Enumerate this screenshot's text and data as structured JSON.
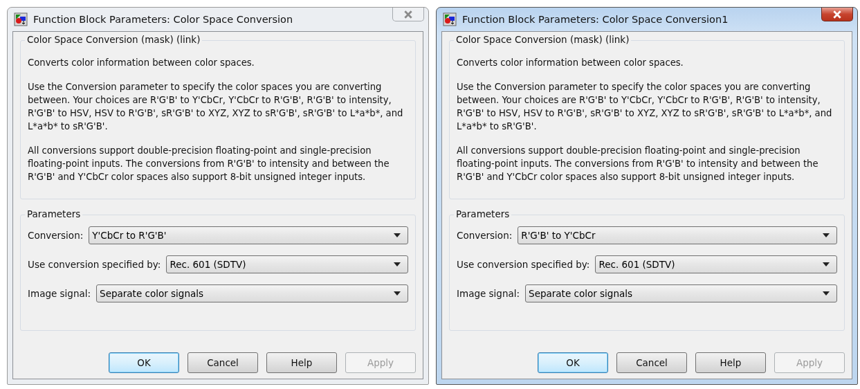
{
  "windows": [
    {
      "title": "Function Block Parameters: Color Space Conversion",
      "active": false,
      "description_group": {
        "title": "Color Space Conversion (mask) (link)",
        "paragraphs": [
          "Converts color information between color spaces.",
          "Use the Conversion parameter to specify the color spaces you are converting between. Your choices are R'G'B' to Y'CbCr, Y'CbCr to R'G'B', R'G'B' to intensity, R'G'B' to HSV, HSV to R'G'B', sR'G'B' to XYZ, XYZ to sR'G'B', sR'G'B' to L*a*b*, and L*a*b* to sR'G'B'.",
          "All conversions support double-precision floating-point and single-precision floating-point inputs. The conversions from R'G'B' to intensity and between the R'G'B' and Y'CbCr color spaces also support 8-bit unsigned integer inputs."
        ]
      },
      "parameters_group": {
        "title": "Parameters",
        "fields": [
          {
            "label": "Conversion:",
            "value": "Y'CbCr to R'G'B'"
          },
          {
            "label": "Use conversion specified by:",
            "value": "Rec. 601 (SDTV)"
          },
          {
            "label": "Image signal:",
            "value": "Separate color signals"
          }
        ]
      },
      "buttons": [
        {
          "label": "OK",
          "default": true,
          "disabled": false
        },
        {
          "label": "Cancel",
          "default": false,
          "disabled": false
        },
        {
          "label": "Help",
          "default": false,
          "disabled": false
        },
        {
          "label": "Apply",
          "default": false,
          "disabled": true
        }
      ]
    },
    {
      "title": "Function Block Parameters: Color Space Conversion1",
      "active": true,
      "description_group": {
        "title": "Color Space Conversion (mask) (link)",
        "paragraphs": [
          "Converts color information between color spaces.",
          "Use the Conversion parameter to specify the color spaces you are converting between. Your choices are R'G'B' to Y'CbCr, Y'CbCr to R'G'B', R'G'B' to intensity, R'G'B' to HSV, HSV to R'G'B', sR'G'B' to XYZ, XYZ to sR'G'B', sR'G'B' to L*a*b*, and L*a*b* to sR'G'B'.",
          "All conversions support double-precision floating-point and single-precision floating-point inputs. The conversions from R'G'B' to intensity and between the R'G'B' and Y'CbCr color spaces also support 8-bit unsigned integer inputs."
        ]
      },
      "parameters_group": {
        "title": "Parameters",
        "fields": [
          {
            "label": "Conversion:",
            "value": "R'G'B' to Y'CbCr"
          },
          {
            "label": "Use conversion specified by:",
            "value": "Rec. 601 (SDTV)"
          },
          {
            "label": "Image signal:",
            "value": "Separate color signals"
          }
        ]
      },
      "buttons": [
        {
          "label": "OK",
          "default": true,
          "disabled": false
        },
        {
          "label": "Cancel",
          "default": false,
          "disabled": false
        },
        {
          "label": "Help",
          "default": false,
          "disabled": false
        },
        {
          "label": "Apply",
          "default": false,
          "disabled": true
        }
      ]
    }
  ]
}
